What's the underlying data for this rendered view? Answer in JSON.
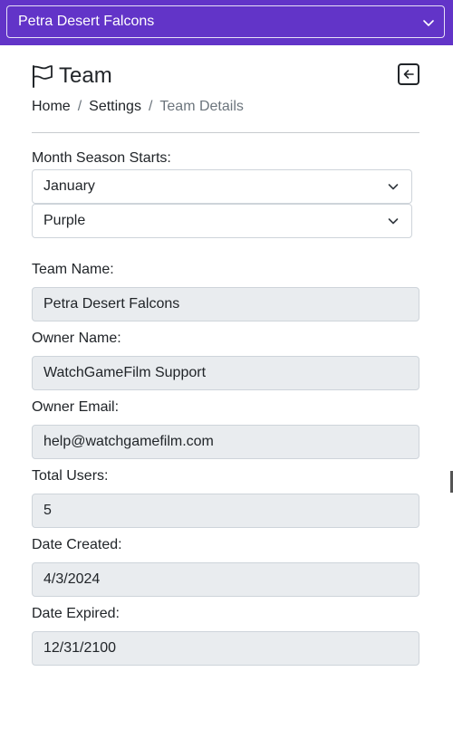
{
  "team_selector": {
    "value": "Petra Desert Falcons"
  },
  "header": {
    "title": "Team"
  },
  "breadcrumb": [
    "Home",
    "Settings",
    "Team Details"
  ],
  "season": {
    "label": "Month Season Starts:",
    "value": "January"
  },
  "color": {
    "value": "Purple"
  },
  "fields": [
    {
      "label": "Team Name:",
      "value": "Petra Desert Falcons"
    },
    {
      "label": "Owner Name:",
      "value": "WatchGameFilm Support"
    },
    {
      "label": "Owner Email:",
      "value": "help@watchgamefilm.com"
    },
    {
      "label": "Total Users:",
      "value": "5"
    },
    {
      "label": "Date Created:",
      "value": "4/3/2024"
    },
    {
      "label": "Date Expired:",
      "value": "12/31/2100"
    }
  ],
  "colors": {
    "topbar": "#6234c8",
    "readonly_field": "#e9ecef",
    "muted_text": "#6c757d"
  },
  "icons": [
    "chevron-down-icon",
    "flag-icon",
    "arrow-left-square-icon"
  ]
}
